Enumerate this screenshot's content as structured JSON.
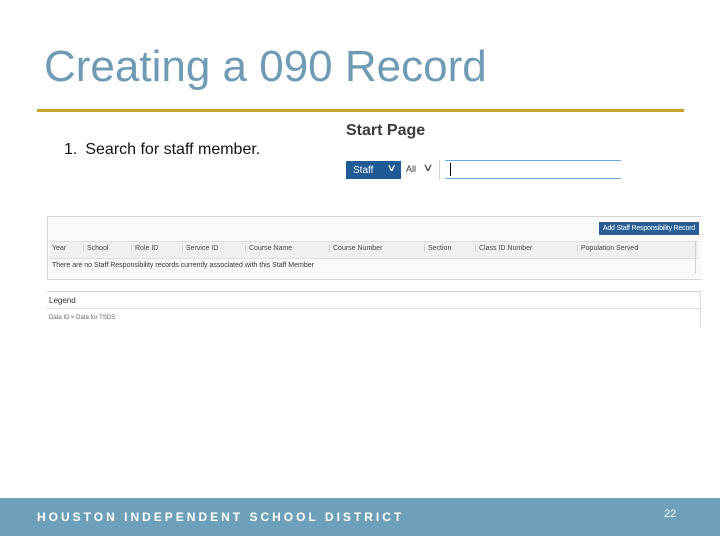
{
  "slide": {
    "title": "Creating a 090 Record",
    "step_number": "1.",
    "step_text": "Search for staff member."
  },
  "app": {
    "start_page_title": "Start Page",
    "search": {
      "scope_button": "Staff",
      "filter_label": "All",
      "value": ""
    },
    "grid": {
      "add_button": "Add Staff Responsibility Record",
      "columns": [
        "Year",
        "School",
        "Role ID",
        "Service ID",
        "Course Name",
        "Course Number",
        "Section",
        "Class ID Number",
        "Population Served"
      ],
      "empty_message": "There are no Staff Responsibility records currently associated with this Staff Member"
    },
    "legend": {
      "title": "Legend",
      "item": "Data ID = Data for TSDS"
    }
  },
  "footer": {
    "org": "HOUSTON INDEPENDENT SCHOOL DISTRICT",
    "page_number": "22"
  },
  "colors": {
    "title": "#6f9bb5",
    "rule": "#c9a227",
    "footer": "#6fa0ba",
    "app_button": "#1f5a96"
  }
}
